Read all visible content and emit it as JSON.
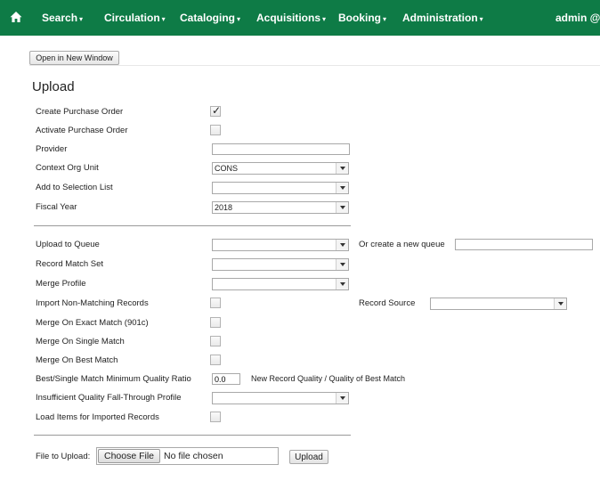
{
  "nav": {
    "home_icon": "home-icon",
    "items": [
      {
        "label": "Search"
      },
      {
        "label": "Circulation"
      },
      {
        "label": "Cataloging"
      },
      {
        "label": "Acquisitions"
      },
      {
        "label": "Booking"
      },
      {
        "label": "Administration"
      }
    ],
    "caret": "▾",
    "user": "admin @ C"
  },
  "toolbar": {
    "open_new_window": "Open in New Window"
  },
  "page": {
    "title": "Upload"
  },
  "form": {
    "create_po": {
      "label": "Create Purchase Order",
      "checked": true,
      "mark": "✓"
    },
    "activate_po": {
      "label": "Activate Purchase Order",
      "checked": false
    },
    "provider": {
      "label": "Provider",
      "value": ""
    },
    "context_org": {
      "label": "Context Org Unit",
      "value": "CONS"
    },
    "selection_list": {
      "label": "Add to Selection List",
      "value": ""
    },
    "fiscal_year": {
      "label": "Fiscal Year",
      "value": "2018"
    },
    "upload_queue": {
      "label": "Upload to Queue",
      "value": ""
    },
    "new_queue": {
      "label": "Or create a new queue",
      "value": ""
    },
    "record_match_set": {
      "label": "Record Match Set",
      "value": ""
    },
    "merge_profile": {
      "label": "Merge Profile",
      "value": ""
    },
    "import_non_matching": {
      "label": "Import Non-Matching Records",
      "checked": false
    },
    "record_source": {
      "label": "Record Source",
      "value": ""
    },
    "merge_exact": {
      "label": "Merge On Exact Match (901c)",
      "checked": false
    },
    "merge_single": {
      "label": "Merge On Single Match",
      "checked": false
    },
    "merge_best": {
      "label": "Merge On Best Match",
      "checked": false
    },
    "min_quality": {
      "label": "Best/Single Match Minimum Quality Ratio",
      "value": "0.0",
      "hint": "New Record Quality / Quality of Best Match"
    },
    "fallthrough": {
      "label": "Insufficient Quality Fall-Through Profile",
      "value": ""
    },
    "load_items": {
      "label": "Load Items for Imported Records",
      "checked": false
    },
    "file": {
      "label": "File to Upload:",
      "choose": "Choose File",
      "status": "No file chosen"
    },
    "upload_button": "Upload"
  }
}
